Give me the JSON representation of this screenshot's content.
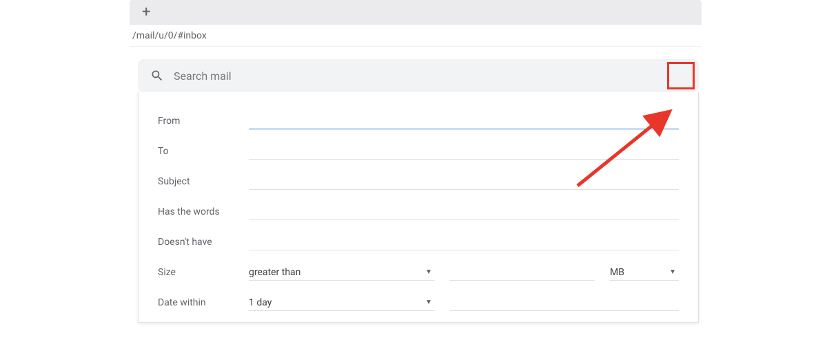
{
  "browser": {
    "url_fragment": "/mail/u/0/#inbox"
  },
  "search": {
    "placeholder": "Search mail"
  },
  "form": {
    "from": {
      "label": "From",
      "value": ""
    },
    "to": {
      "label": "To",
      "value": ""
    },
    "subject": {
      "label": "Subject",
      "value": ""
    },
    "has_words": {
      "label": "Has the words",
      "value": ""
    },
    "doesnt_have": {
      "label": "Doesn't have",
      "value": ""
    },
    "size": {
      "label": "Size",
      "operator": "greater than",
      "value": "",
      "unit": "MB"
    },
    "date_within": {
      "label": "Date within",
      "range": "1 day",
      "value": ""
    }
  }
}
